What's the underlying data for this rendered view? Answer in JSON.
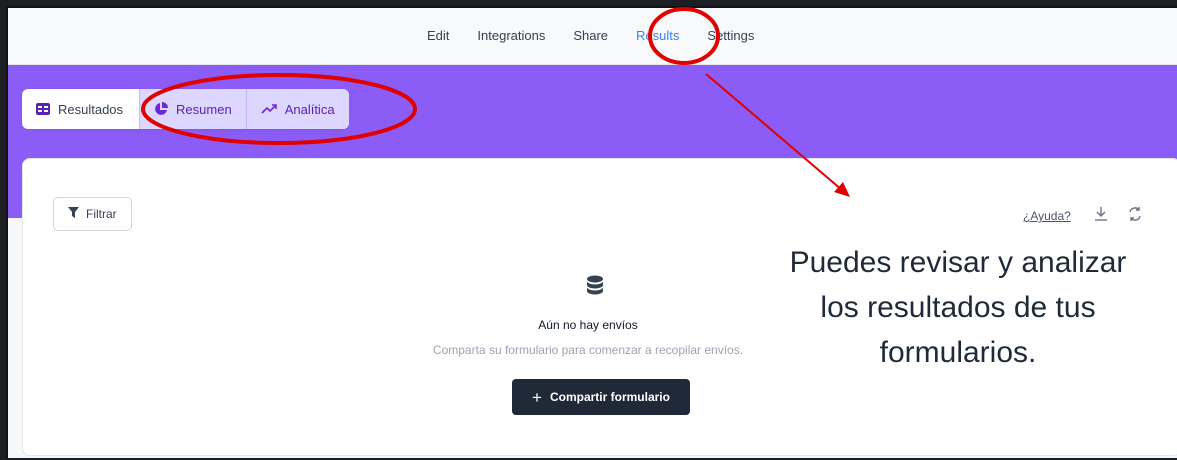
{
  "nav": {
    "items": [
      "Edit",
      "Integrations",
      "Share",
      "Results",
      "Settings"
    ],
    "active": "Results"
  },
  "tabs": {
    "resultados": "Resultados",
    "resumen": "Resumen",
    "analitica": "Analítica"
  },
  "toolbar": {
    "filter_label": "Filtrar",
    "help_label": "¿Ayuda?",
    "download_icon": "download-icon",
    "refresh_icon": "refresh-icon"
  },
  "empty_state": {
    "icon": "database-icon",
    "title": "Aún no hay envíos",
    "subtitle": "Comparta su formulario para comenzar a recopilar envíos.",
    "button_label": "Compartir formulario"
  },
  "annotation": {
    "line1": "Puedes revisar y analizar",
    "line2": "los resultados de tus",
    "line3": "formularios."
  },
  "colors": {
    "accent_purple": "#8b5cf6",
    "nav_active": "#3b82f6",
    "annotation_red": "#e00000",
    "button_dark": "#1f2937"
  }
}
